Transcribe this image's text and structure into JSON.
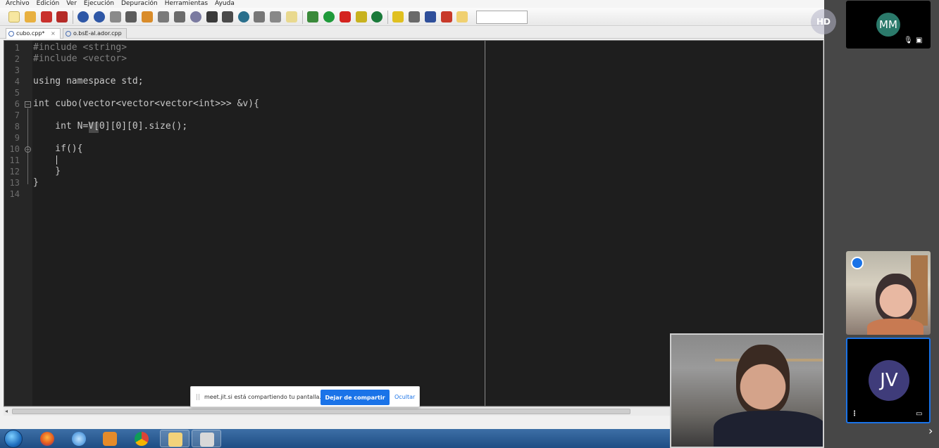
{
  "menu": [
    "Archivo",
    "Edición",
    "Ver",
    "Ejecución",
    "Depuración",
    "Herramientas",
    "Ayuda"
  ],
  "tabs": [
    {
      "label": "cubo.cpp*",
      "close": "×"
    },
    {
      "label": "o.bsE-al.ador.cpp"
    }
  ],
  "editor": {
    "line_numbers": [
      "1",
      "2",
      "3",
      "4",
      "5",
      "6",
      "7",
      "8",
      "9",
      "10",
      "11",
      "12",
      "13",
      "14"
    ],
    "lines": [
      "#include <string>",
      "#include <vector>",
      "",
      "using namespace std;",
      "",
      "int cubo(vector<vector<vector<int>>> &v){",
      "",
      "    int N=V[0][0][0].size();",
      "",
      "    if(){",
      "    ",
      "    }",
      "}",
      ""
    ]
  },
  "share_bar": {
    "grip": "||",
    "message": "meet.jit.si está compartiendo tu pantalla.",
    "stop_label": "Dejar de compartir",
    "hide_label": "Ocultar"
  },
  "participants": {
    "local_badge": "HD",
    "mm_initials": "MM",
    "jv_initials": "JV",
    "mm_colors": {
      "avatar": "#2b7a6b"
    },
    "jv_colors": {
      "avatar": "#3f3c7a",
      "border": "#1a73e8"
    }
  },
  "icons": {
    "next": "chevron-right-icon",
    "mute": "mic-off-icon",
    "cam_off": "camera-off-icon",
    "menu": "more-vertical-icon",
    "screen": "screen-share-icon",
    "speaker": "speaker-badge-icon"
  }
}
